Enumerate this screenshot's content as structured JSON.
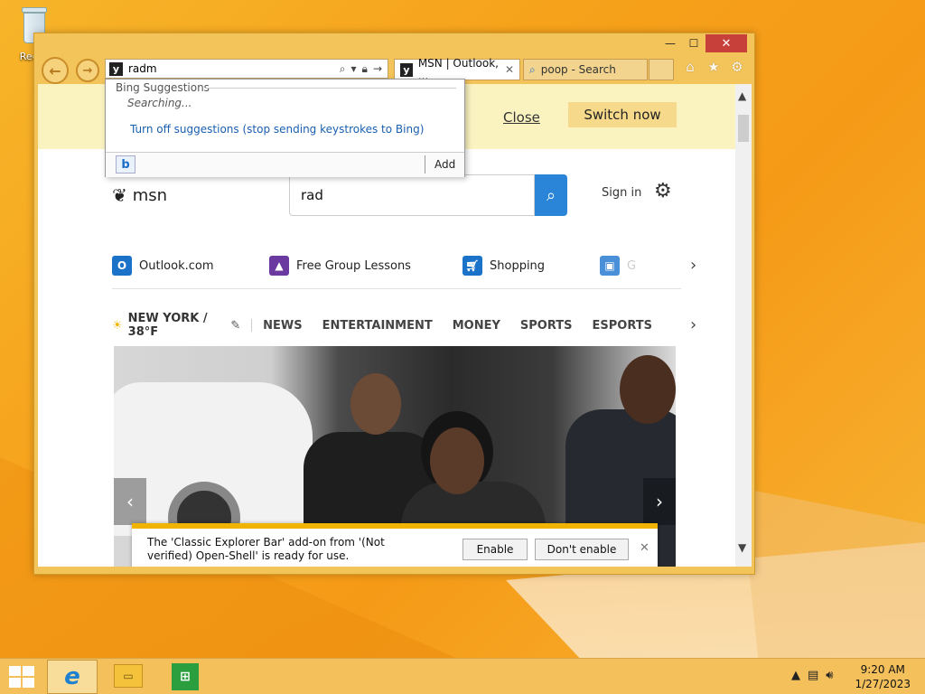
{
  "desktop": {
    "recycle_bin_label": "Recyc"
  },
  "window": {
    "controls": {
      "minimize": "—",
      "maximize": "☐",
      "close": "✕"
    },
    "address_bar": {
      "value": "radm",
      "icons": [
        "search-icon",
        "dropdown-icon",
        "lock-icon",
        "go-icon"
      ]
    },
    "tabs": [
      {
        "label": "MSN | Outlook, ...",
        "close": "✕",
        "active": true
      },
      {
        "label": "poop - Search",
        "active": false
      }
    ],
    "right_icons": [
      "home-icon",
      "star-icon",
      "gear-icon"
    ]
  },
  "suggestions": {
    "header": "Bing Suggestions",
    "status": "Searching...",
    "turn_off_link": "Turn off suggestions (stop sending keystrokes to Bing)",
    "add_label": "Add",
    "bing_icon": "b"
  },
  "banner": {
    "close_label": "Close",
    "switch_label": "Switch now"
  },
  "msn": {
    "logo_text": "msn",
    "search_value": "rad",
    "sign_in": "Sign in",
    "quick_links": [
      {
        "label": "Outlook.com",
        "icon": "outlook-icon",
        "color": "#1a73c8"
      },
      {
        "label": "Free Group Lessons",
        "icon": "graduation-cap-icon",
        "color": "#6b3aa0"
      },
      {
        "label": "Shopping",
        "icon": "shopping-cart-icon",
        "color": "#1a73c8"
      },
      {
        "label": "G",
        "icon": "car-icon",
        "color": "#4a90d9"
      }
    ],
    "weather": "NEW YORK / 38°F",
    "categories": [
      "NEWS",
      "ENTERTAINMENT",
      "MONEY",
      "SPORTS",
      "ESPORTS"
    ]
  },
  "notification": {
    "message": "The 'Classic Explorer Bar' add-on from '(Not verified) Open-Shell' is ready for use.",
    "enable_label": "Enable",
    "dont_enable_label": "Don't enable",
    "close": "✕"
  },
  "taskbar": {
    "time": "9:20 AM",
    "date": "1/27/2023"
  }
}
